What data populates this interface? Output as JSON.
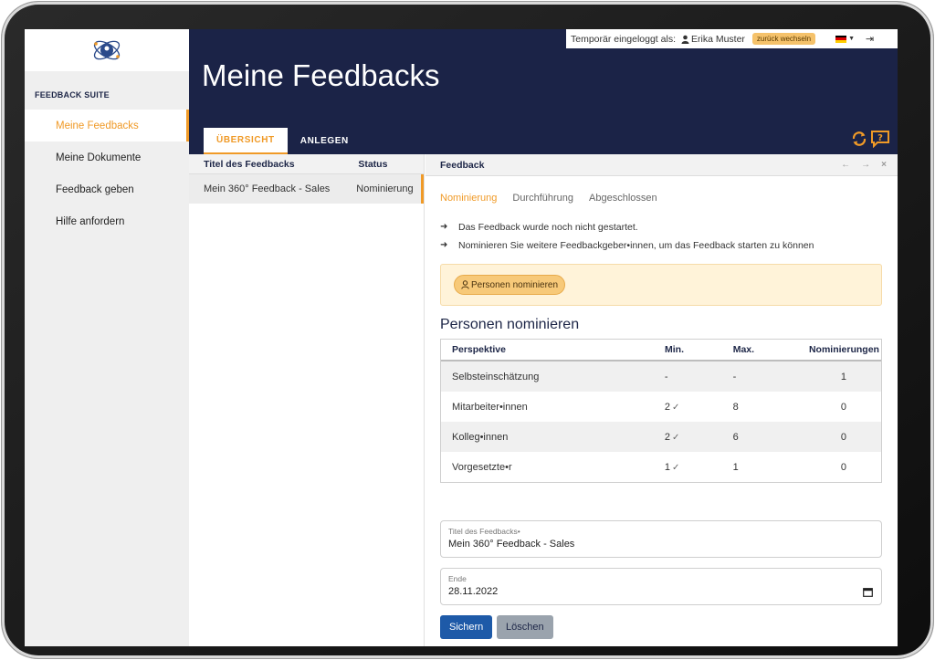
{
  "sidebar": {
    "suite_title": "FEEDBACK SUITE",
    "items": [
      {
        "label": "Meine Feedbacks",
        "active": true
      },
      {
        "label": "Meine Dokumente"
      },
      {
        "label": "Feedback geben"
      },
      {
        "label": "Hilfe anfordern"
      }
    ]
  },
  "topbar": {
    "temp_login_label": "Temporär eingeloggt als:",
    "user_name": "Erika Muster",
    "switch_back_label": "zurück wechseln"
  },
  "header": {
    "title": "Meine Feedbacks",
    "tabs": [
      {
        "label": "ÜBERSICHT",
        "active": true
      },
      {
        "label": "ANLEGEN"
      }
    ]
  },
  "list": {
    "columns": [
      "Titel des Feedbacks",
      "Status"
    ],
    "rows": [
      {
        "title": "Mein 360° Feedback - Sales",
        "status": "Nominierung"
      }
    ]
  },
  "detail": {
    "title": "Feedback",
    "controls": {
      "prev": "←",
      "next": "→",
      "close": "×"
    },
    "subtabs": [
      {
        "label": "Nominierung",
        "active": true
      },
      {
        "label": "Durchführung"
      },
      {
        "label": "Abgeschlossen"
      }
    ],
    "info_lines": [
      "Das Feedback wurde noch nicht gestartet.",
      "Nominieren Sie weitere Feedbackgeber•innen, um das Feedback starten zu können"
    ],
    "nominate_button": "Personen nominieren",
    "section_title": "Personen nominieren",
    "table": {
      "columns": [
        "Perspektive",
        "Min.",
        "Max.",
        "Nominierungen"
      ],
      "rows": [
        {
          "perspective": "Selbsteinschätzung",
          "min": "-",
          "min_check": "",
          "max": "-",
          "nominations": "1"
        },
        {
          "perspective": "Mitarbeiter•innen",
          "min": "2",
          "min_check": "✓",
          "max": "8",
          "nominations": "0"
        },
        {
          "perspective": "Kolleg•innen",
          "min": "2",
          "min_check": "✓",
          "max": "6",
          "nominations": "0"
        },
        {
          "perspective": "Vorgesetzte•r",
          "min": "1",
          "min_check": "✓",
          "max": "1",
          "nominations": "0"
        }
      ]
    },
    "fields": {
      "title_label": "Titel des Feedbacks•",
      "title_value": "Mein 360° Feedback - Sales",
      "end_label": "Ende",
      "end_value": "28.11.2022"
    },
    "buttons": {
      "save": "Sichern",
      "delete": "Löschen"
    }
  },
  "colors": {
    "accent": "#f09a27",
    "header_bg": "#1b2347",
    "save_button": "#1e5aa8",
    "delete_button": "#9aa3ad"
  },
  "icons": [
    "logo-icon",
    "user-icon",
    "flag-de-icon",
    "logout-icon",
    "refresh-icon",
    "help-icon",
    "user-outline-icon",
    "calendar-icon",
    "check-icon",
    "arrow-right-icon"
  ]
}
